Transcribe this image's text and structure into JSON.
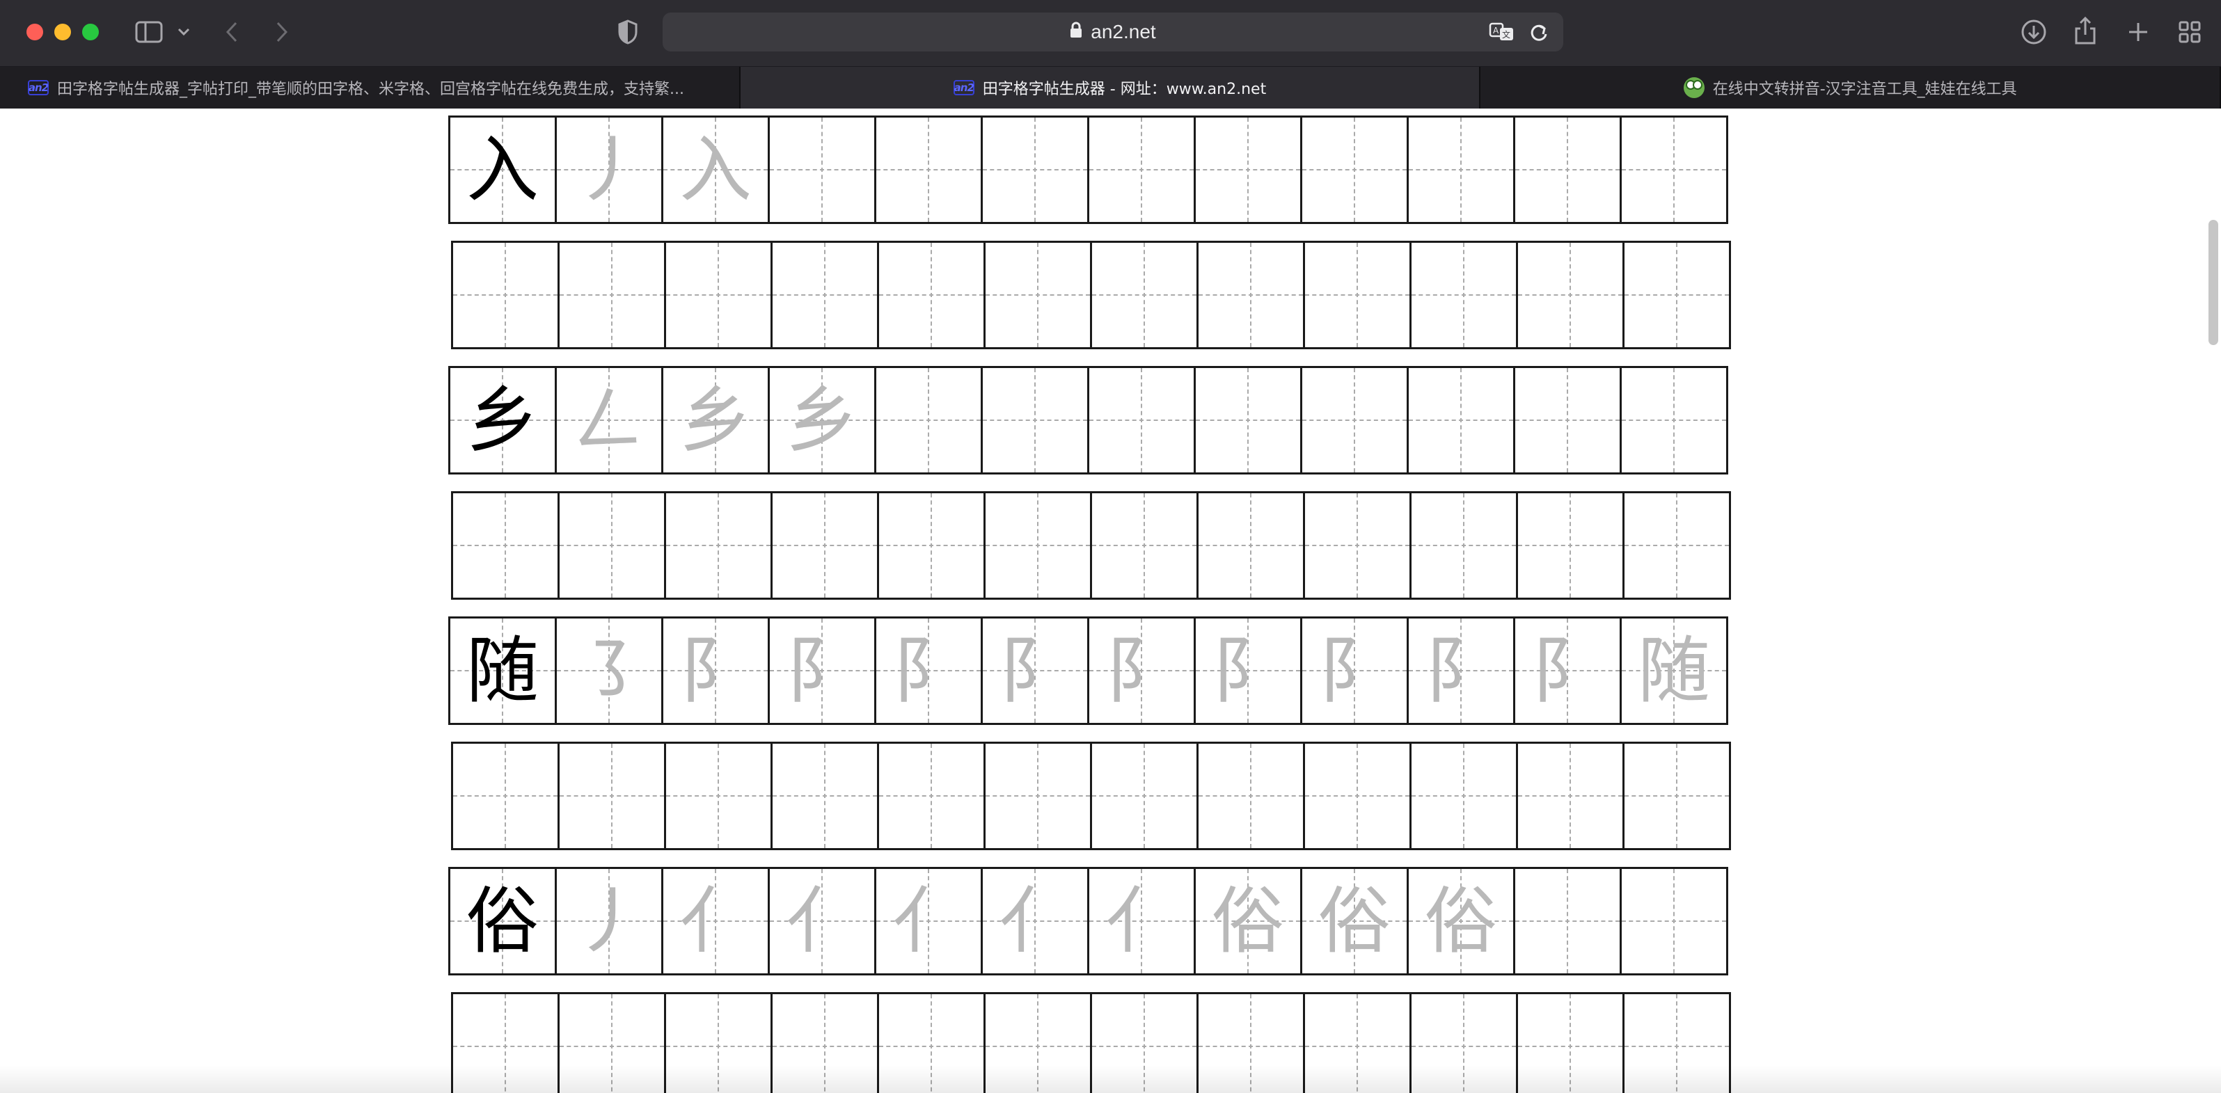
{
  "browser": {
    "url": "an2.net",
    "tabs": [
      {
        "title": "田字格字帖生成器_字帖打印_带笔顺的田字格、米字格、回宫格字帖在线免费生成，支持繁...",
        "favicon": "an2-logo-icon",
        "active": false
      },
      {
        "title": "田字格字帖生成器 - 网址：www.an2.net",
        "favicon": "an2-logo-icon",
        "active": true
      },
      {
        "title": "在线中文转拼音-汉字注音工具_娃娃在线工具",
        "favicon": "frog-icon",
        "active": false
      }
    ],
    "favicon_text": "an2",
    "colors": {
      "toolbar": "#2d2c31",
      "tabbar": "#1f1e22",
      "close": "#fe5f57",
      "minimize": "#febc2e",
      "zoom": "#28c840"
    }
  },
  "worksheet": {
    "style": "tianzige",
    "columns": 12,
    "colors": {
      "border": "#1a1a1a",
      "guide": "#aaaaaa",
      "model": "#000000",
      "trace": "#b9b9b9"
    },
    "rows": [
      {
        "type": "practice",
        "model": "入",
        "strokes": [
          "丿",
          "入"
        ]
      },
      {
        "type": "blank"
      },
      {
        "type": "practice",
        "model": "乡",
        "strokes": [
          "𠃋",
          "乡",
          "乡"
        ]
      },
      {
        "type": "blank"
      },
      {
        "type": "practice",
        "model": "随",
        "strokes": [
          "㇌",
          "阝",
          "阝",
          "阝",
          "阝",
          "阝",
          "阝",
          "阝",
          "阝",
          "阝",
          "随"
        ]
      },
      {
        "type": "blank"
      },
      {
        "type": "practice",
        "model": "俗",
        "strokes": [
          "丿",
          "亻",
          "亻",
          "亻",
          "亻",
          "亻",
          "俗",
          "俗",
          "俗"
        ]
      },
      {
        "type": "blank"
      }
    ]
  }
}
